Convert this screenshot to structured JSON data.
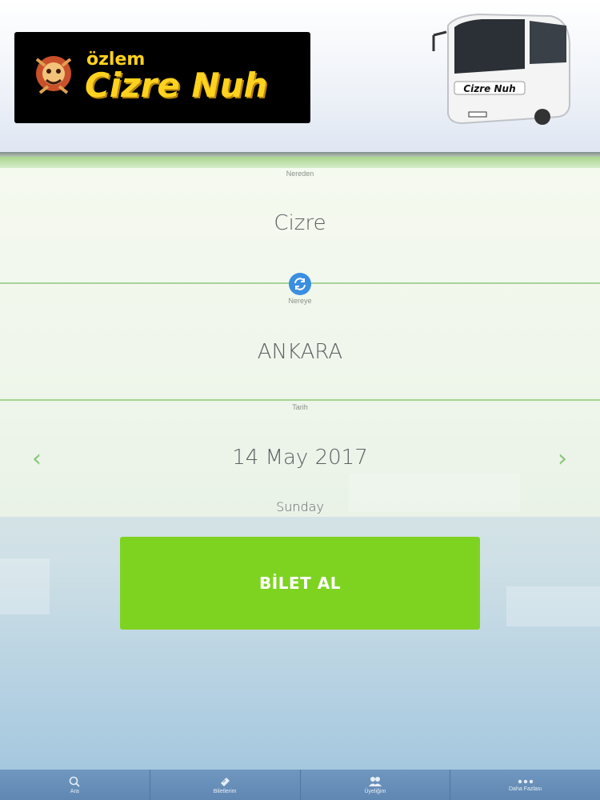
{
  "header": {
    "logo_small": "özlem",
    "logo_big": "Cizre Nuh",
    "bus_sign": "Cizre Nuh"
  },
  "form": {
    "from_label": "Nereden",
    "from_value": "Cizre",
    "to_label": "Nereye",
    "to_value": "ANKARA",
    "date_label": "Tarih",
    "date_value": "14 May 2017",
    "weekday": "Sunday",
    "prev_arrow": "‹",
    "next_arrow": "›"
  },
  "buy_button": "BİLET AL",
  "tabs": [
    {
      "label": "Ara",
      "icon": "search-icon"
    },
    {
      "label": "Biletlerim",
      "icon": "ticket-icon"
    },
    {
      "label": "Üyeliğim",
      "icon": "users-icon"
    },
    {
      "label": "Daha Fazlası",
      "icon": "more-icon"
    }
  ],
  "colors": {
    "accent_green": "#7ed321",
    "swap_blue": "#3b8fe0",
    "logo_yellow": "#ffd21f",
    "tabbar": "#6f97bf"
  }
}
